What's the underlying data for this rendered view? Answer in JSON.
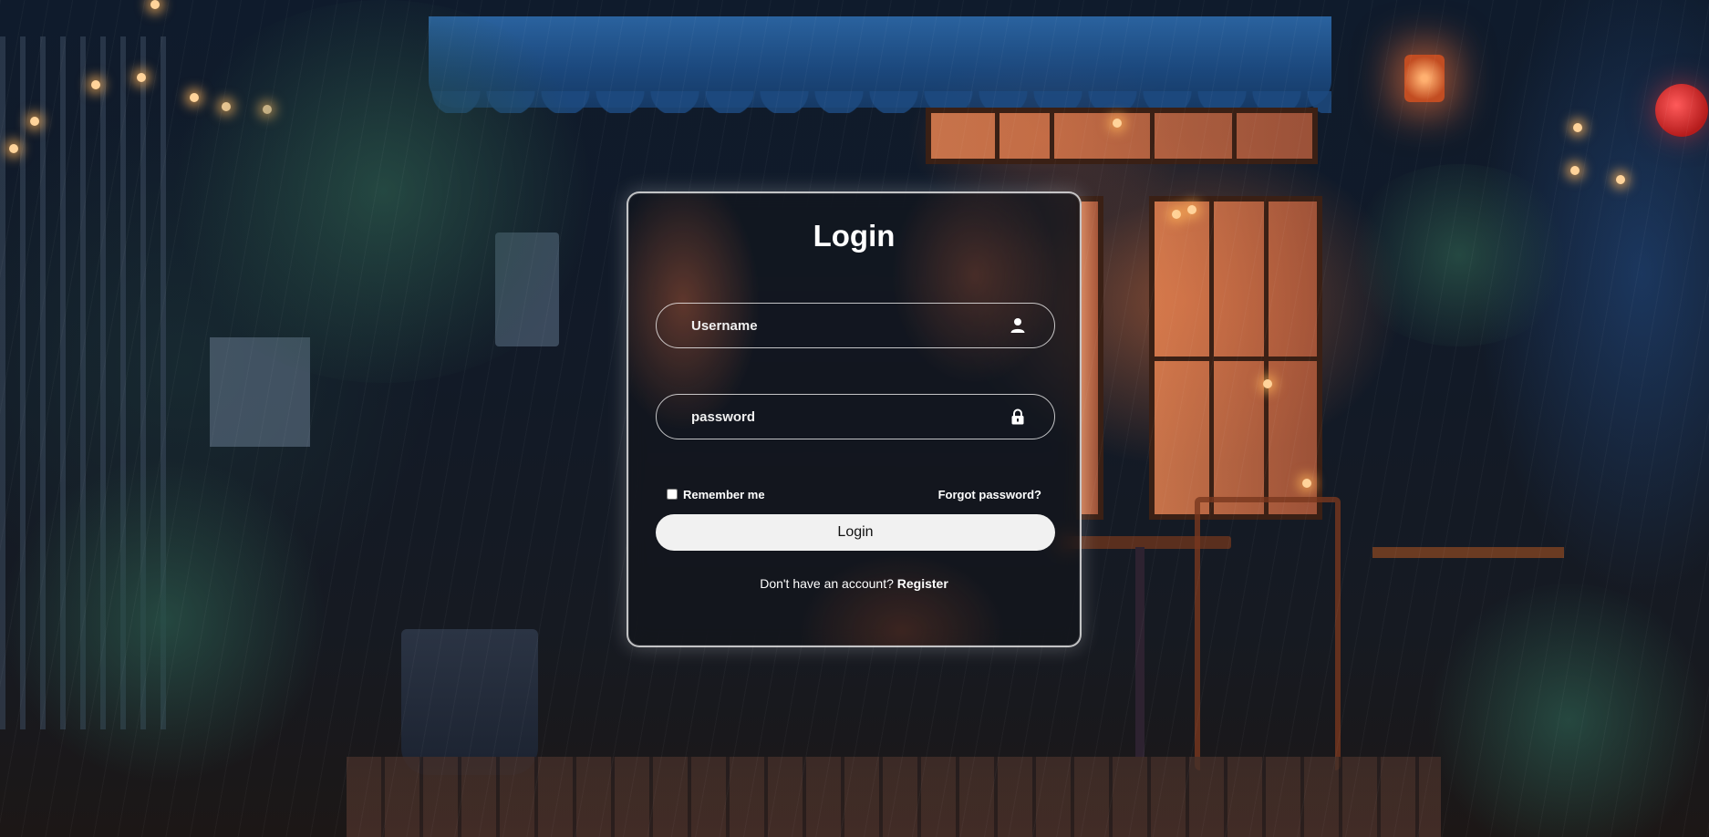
{
  "form": {
    "title": "Login",
    "username": {
      "placeholder": "Username",
      "icon": "user-icon"
    },
    "password": {
      "placeholder": "password",
      "icon": "lock-icon"
    },
    "remember_label": "Remember me",
    "remember_checked": false,
    "forgot_label": "Forgot password?",
    "submit_label": "Login",
    "register_prompt": "Don't have an account?",
    "register_label": "Register"
  }
}
